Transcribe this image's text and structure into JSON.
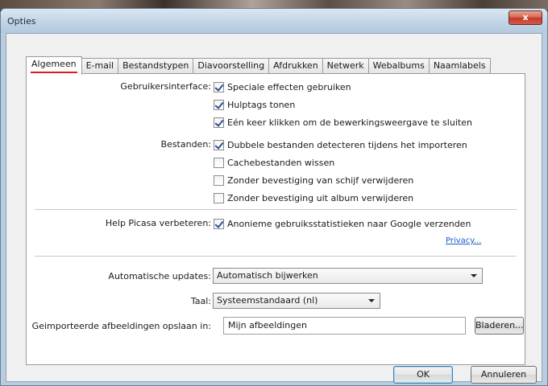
{
  "window": {
    "title": "Opties",
    "close_glyph": "x"
  },
  "tabs": [
    {
      "label": "Algemeen",
      "active": true
    },
    {
      "label": "E-mail"
    },
    {
      "label": "Bestandstypen"
    },
    {
      "label": "Diavoorstelling"
    },
    {
      "label": "Afdrukken"
    },
    {
      "label": "Netwerk"
    },
    {
      "label": "Webalbums"
    },
    {
      "label": "Naamlabels"
    }
  ],
  "general": {
    "ui_label": "Gebruikersinterface:",
    "ui_options": [
      {
        "label": "Speciale effecten gebruiken",
        "checked": true
      },
      {
        "label": "Hulptags tonen",
        "checked": true
      },
      {
        "label": "Eén keer klikken om de bewerkingsweergave te sluiten",
        "checked": true
      }
    ],
    "files_label": "Bestanden:",
    "files_options": [
      {
        "label": "Dubbele bestanden detecteren tijdens het importeren",
        "checked": true
      },
      {
        "label": "Cachebestanden wissen",
        "checked": false
      },
      {
        "label": "Zonder bevestiging van schijf verwijderen",
        "checked": false
      },
      {
        "label": "Zonder bevestiging uit album verwijderen",
        "checked": false
      }
    ],
    "improve_label": "Help Picasa verbeteren:",
    "improve_option": {
      "label": "Anonieme gebruiksstatistieken naar Google verzenden",
      "checked": true
    },
    "privacy_link": "Privacy...",
    "updates_label": "Automatische updates:",
    "updates_value": "Automatisch bijwerken",
    "language_label": "Taal:",
    "language_value": "Systeemstandaard (nl)",
    "import_label": "Geimporteerde afbeeldingen opslaan in:",
    "import_value": "Mijn afbeeldingen",
    "browse_label": "Bladeren..."
  },
  "footer": {
    "ok_label": "OK",
    "cancel_label": "Annuleren"
  }
}
